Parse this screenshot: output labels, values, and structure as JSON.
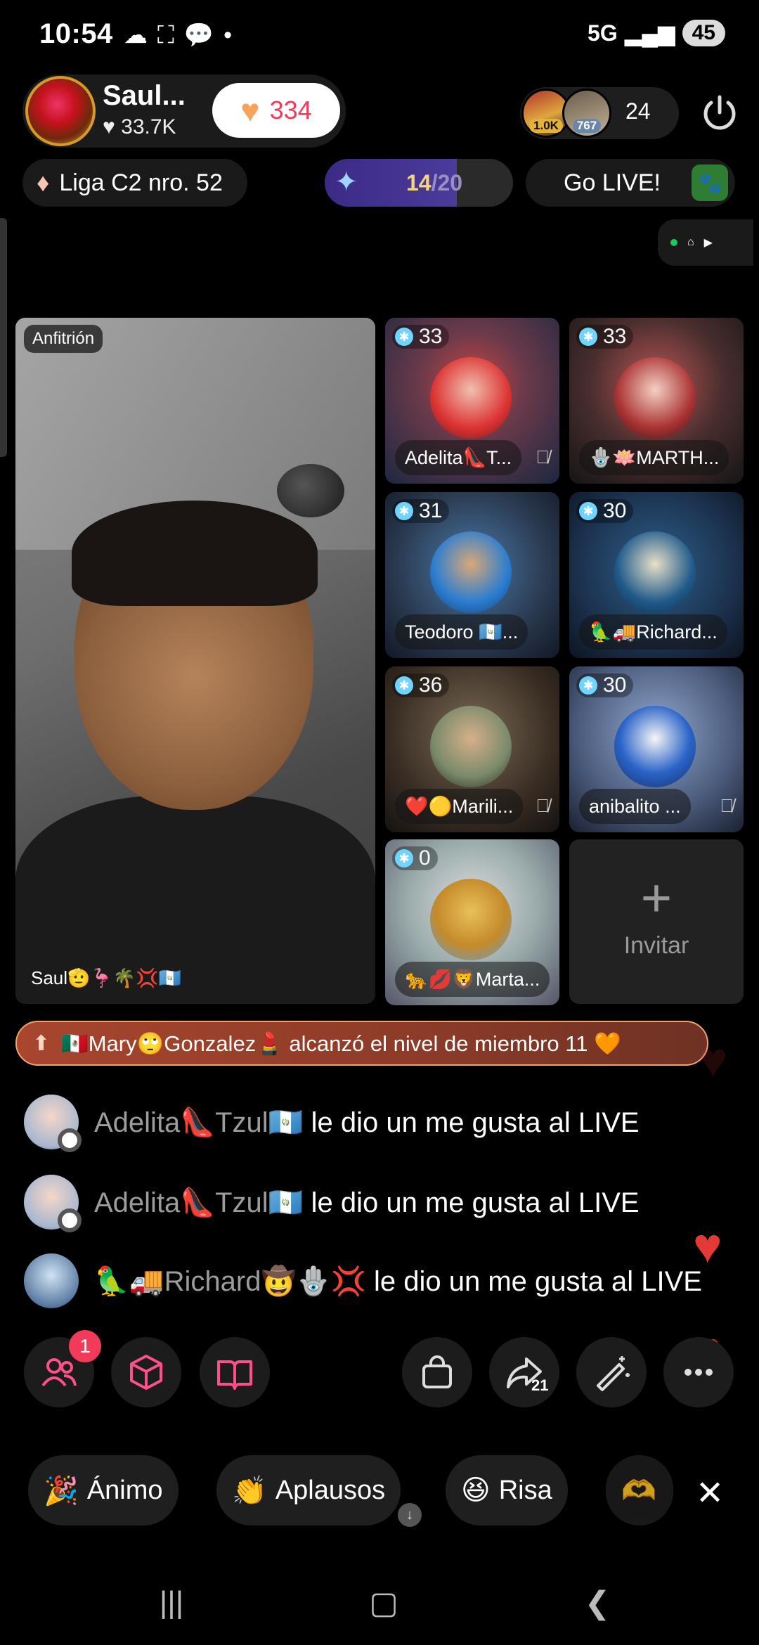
{
  "status_bar": {
    "time": "10:54",
    "network": "5G",
    "battery": "45",
    "icons": [
      "cloud-icon",
      "screenshot-icon",
      "chat-bubble-icon",
      "dot-icon"
    ]
  },
  "header": {
    "host_name": "Saul...",
    "host_likes": "33.7K",
    "like_count": "334",
    "viewer_badges": [
      "1.0K",
      "767"
    ],
    "viewer_count": "24"
  },
  "subheader": {
    "league": "Liga C2 nro. 52",
    "progress_current": "14",
    "progress_total": "/20",
    "progress_fraction": 0.7,
    "go_live": "Go LIVE!"
  },
  "host_video": {
    "role_badge": "Anfitrión",
    "name": "Saul🫡🦩🌴💢🇬🇹"
  },
  "guests": [
    {
      "level": "33",
      "name": "Adelita👠T...",
      "muted": true
    },
    {
      "level": "33",
      "name": "🪬🪷MARTH...",
      "muted": false
    },
    {
      "level": "31",
      "name": "Teodoro 🇬🇹...",
      "muted": false
    },
    {
      "level": "30",
      "name": "🦜🚚Richard...",
      "muted": false
    },
    {
      "level": "36",
      "name": "❤️🟡Marili...",
      "muted": true
    },
    {
      "level": "30",
      "name": "anibalito ...",
      "muted": true
    },
    {
      "level": "0",
      "name": "🐆💋🦁Marta...",
      "muted": false
    }
  ],
  "invite_label": "Invitar",
  "banner": {
    "text": "🇲🇽Mary🙄Gonzalez💄 alcanzó el nivel de miembro 11 🧡"
  },
  "comments": [
    {
      "user": "Adelita👠Tzul🇬🇹",
      "action": "le dio un me gusta al LIVE"
    },
    {
      "user": "Adelita👠Tzul🇬🇹",
      "action": "le dio un me gusta al LIVE"
    },
    {
      "user": "🦜🚚Richard🤠🪬💢",
      "action": "le dio un me gusta al LIVE"
    }
  ],
  "actions": {
    "notification_count": "1",
    "share_count": "21"
  },
  "reactions": [
    {
      "icon": "🎉",
      "label": "Ánimo"
    },
    {
      "icon": "👏",
      "label": "Aplausos"
    },
    {
      "icon": "😆",
      "label": "Risa"
    },
    {
      "icon": "🫶",
      "label": ""
    }
  ],
  "colors": {
    "accent_pink": "#f23a5a",
    "banner_bg": "#a8462e",
    "mic_level_icon": "#6fd4ff",
    "heart_orange": "#f7a35c"
  }
}
